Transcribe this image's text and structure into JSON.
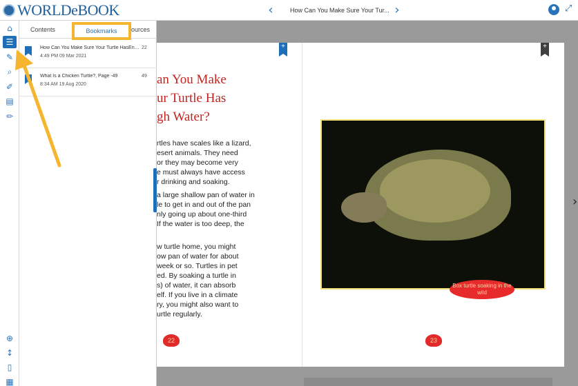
{
  "app": {
    "logo_text": "WORLDeBOOK",
    "book_title": "How Can You Make Sure Your Tur...",
    "icons": [
      "home-icon",
      "list-icon",
      "highlight-icon",
      "search-icon",
      "edit-icon",
      "note-icon",
      "pencil-icon",
      "zoom-in-icon",
      "fit-page-icon",
      "single-page-icon",
      "grid-icon"
    ]
  },
  "panel": {
    "tabs": {
      "contents": "Contents",
      "bookmarks": "Bookmarks",
      "resources": "Resources"
    },
    "bookmarks": [
      {
        "title": "How Can You Make Sure Your Turtle HasEno...",
        "time": "4:49 PM 09 Mar 2021",
        "page": "22"
      },
      {
        "title": "What Is a Chicken Turtle?, Page -49",
        "time": "8:34 AM 19 Aug 2020",
        "page": "49"
      }
    ]
  },
  "book": {
    "left_bookmark": "+",
    "right_bookmark": "+",
    "heading": [
      "an You Make",
      "ur Turtle Has",
      "gh Water?"
    ],
    "para1": [
      "rtles have scales like a lizard,",
      "esert animals. They need",
      "or they may become very",
      "e must always have access",
      "r drinking and soaking."
    ],
    "para2": [
      "a large shallow pan of water in",
      "le to get in and out of the pan",
      "nly going up about one-third",
      "If the water is too deep, the"
    ],
    "para3": [
      "w turtle home, you might",
      "ow pan of water for about",
      "week or so. Turtles in pet",
      "ed. By soaking a turtle in",
      "s) of water, it can absorb",
      "elf. If you live in a climate",
      "ry, you might also want to",
      "urtle regularly."
    ],
    "page_left": "22",
    "page_right": "23",
    "caption": "Box turtle soaking in the wild"
  },
  "colors": {
    "accent": "#1e6fb8",
    "highlight": "#f5b52e",
    "heading": "#c4231f"
  }
}
